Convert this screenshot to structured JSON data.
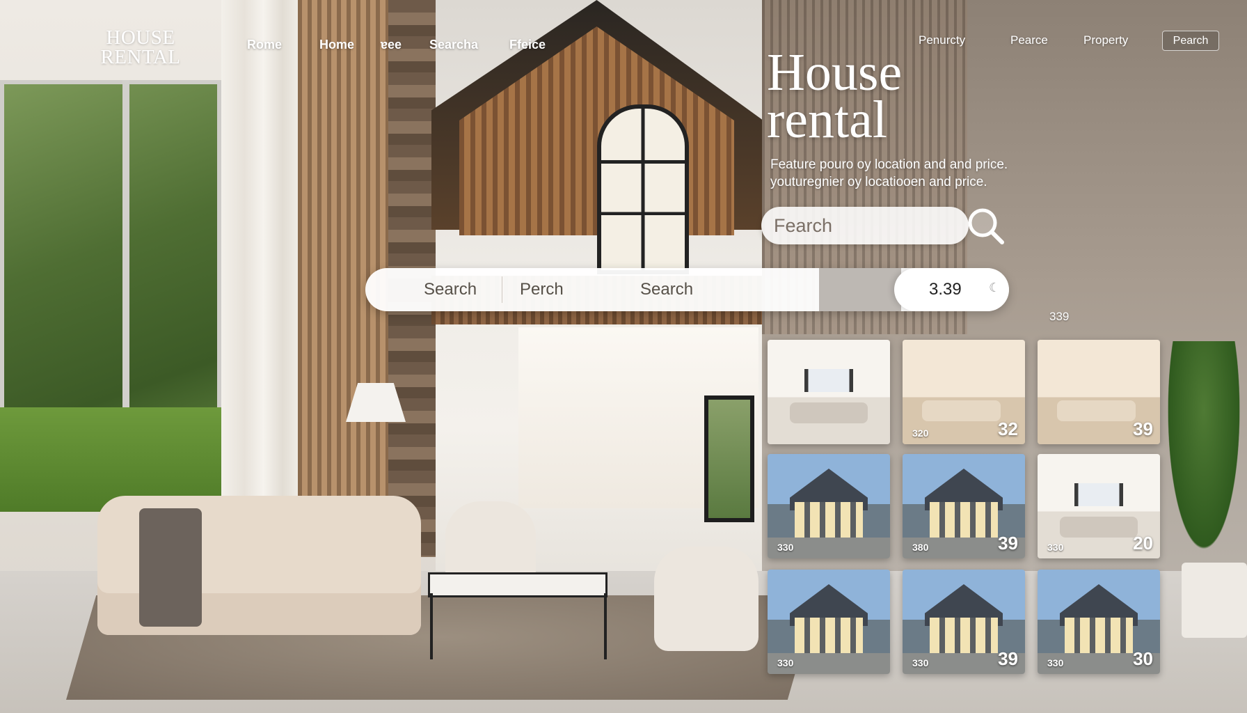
{
  "brand": {
    "line1": "HOUSE",
    "line2": "RENTAL"
  },
  "nav_left": [
    "Rome",
    "Home",
    "ɐee",
    "Searcha",
    "Ffeice"
  ],
  "nav_right": [
    "Penurcty",
    "Pearce",
    "Property"
  ],
  "nav_button": "Pearch",
  "hero": {
    "title_line1": "House",
    "title_line2": "rental",
    "subtitle_line1": "Feature pouro oy location and and price.",
    "subtitle_line2": "youturegnier oy locatiooen and price."
  },
  "small_search": {
    "label": "Fearch"
  },
  "search_bar": {
    "field1": "Search",
    "field2": "Perch",
    "field3": "Search",
    "price_value": "3.39"
  },
  "grid_label": "339",
  "cards": [
    {
      "type": "bed",
      "num": "",
      "big": ""
    },
    {
      "type": "warm",
      "num": "320",
      "big": "32"
    },
    {
      "type": "warm",
      "num": "",
      "big": "39"
    },
    {
      "type": "house",
      "num": "330",
      "big": ""
    },
    {
      "type": "house",
      "num": "380",
      "big": "39"
    },
    {
      "type": "bed",
      "num": "330",
      "big": "20"
    },
    {
      "type": "house",
      "num": "330",
      "big": ""
    },
    {
      "type": "house",
      "num": "330",
      "big": "39"
    },
    {
      "type": "house",
      "num": "330",
      "big": "30"
    }
  ],
  "icons": {
    "search": "magnifier-icon",
    "price_marker": "moon-icon"
  },
  "colors": {
    "hero_text": "#ffffff",
    "search_bg": "#ffffff",
    "accent_dark": "#222222"
  }
}
